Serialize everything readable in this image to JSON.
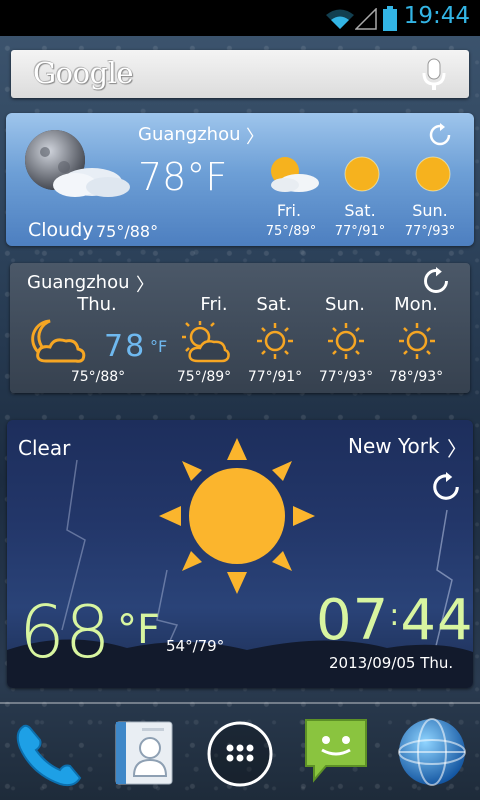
{
  "status_bar": {
    "time": "19:44"
  },
  "search": {
    "logo": "Google"
  },
  "widget1": {
    "city": "Guangzhou",
    "chevron": "〉",
    "temp": "78°F",
    "condition": "Cloudy",
    "range": "75°/88°",
    "forecast": [
      {
        "day": "Fri.",
        "range": "75°/89°",
        "icon": "partly-cloudy-icon"
      },
      {
        "day": "Sat.",
        "range": "77°/91°",
        "icon": "sun-icon"
      },
      {
        "day": "Sun.",
        "range": "77°/93°",
        "icon": "sun-icon"
      }
    ]
  },
  "widget2": {
    "city": "Guangzhou",
    "chevron": "〉",
    "temp": "78",
    "unit": "°F",
    "days": [
      {
        "day": "Thu.",
        "range": "75°/88°",
        "icon": "cloudy-night-icon"
      },
      {
        "day": "Fri.",
        "range": "75°/89°",
        "icon": "partly-cloudy-icon"
      },
      {
        "day": "Sat.",
        "range": "77°/91°",
        "icon": "sun-icon"
      },
      {
        "day": "Sun.",
        "range": "77°/93°",
        "icon": "sun-icon"
      },
      {
        "day": "Mon.",
        "range": "78°/93°",
        "icon": "sun-icon"
      }
    ]
  },
  "widget3": {
    "condition": "Clear",
    "city": "New York",
    "chevron": "〉",
    "temp": "68",
    "unit": "°F",
    "range": "54°/79°",
    "clock_hours": "07",
    "clock_sep": ":",
    "clock_minutes": "44",
    "date": "2013/09/05 Thu."
  },
  "dock": [
    {
      "name": "phone-icon"
    },
    {
      "name": "contacts-icon"
    },
    {
      "name": "app-drawer-icon"
    },
    {
      "name": "messaging-icon"
    },
    {
      "name": "browser-icon"
    }
  ],
  "colors": {
    "status_accent": "#33b5e5",
    "clock_green": "#d8f5a0",
    "icon_orange": "#f6a623"
  }
}
